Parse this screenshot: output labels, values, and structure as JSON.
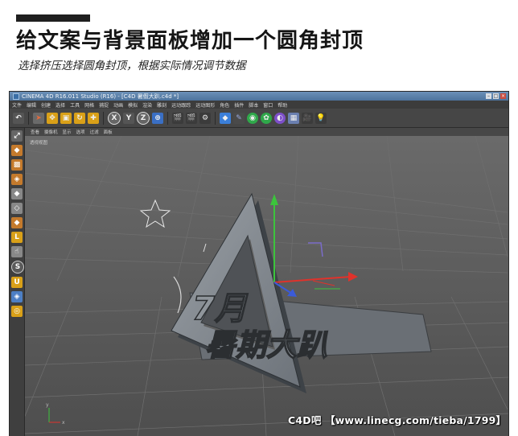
{
  "tutorial": {
    "title": "给文案与背景面板增加一个圆角封顶",
    "subtitle": "选择挤压选择圆角封顶，根据实际情况调节数据"
  },
  "window": {
    "title": "CINEMA 4D R16.011 Studio (R16) - [C4D 暑假大趴.c4d *]",
    "menu": [
      "文件",
      "编辑",
      "创建",
      "选择",
      "工具",
      "网格",
      "捕捉",
      "动画",
      "模拟",
      "渲染",
      "雕刻",
      "运动跟踪",
      "运动图形",
      "角色",
      "插件",
      "脚本",
      "窗口",
      "帮助"
    ]
  },
  "toolbar": {
    "x_label": "X",
    "y_label": "Y",
    "z_label": "Z"
  },
  "viewport": {
    "menu": [
      "查看",
      "摄像机",
      "显示",
      "选项",
      "过滤",
      "面板"
    ],
    "label": "透视视图",
    "logo_text_top": "7月",
    "logo_text_bottom": "暑期大趴"
  },
  "watermark": "C4D吧 【www.linecg.com/tieba/1799】",
  "colors": {
    "title_bar": "#4d739c",
    "axis_x": "#e0322b",
    "axis_y": "#3cc43c",
    "axis_z": "#3b5bd9"
  }
}
